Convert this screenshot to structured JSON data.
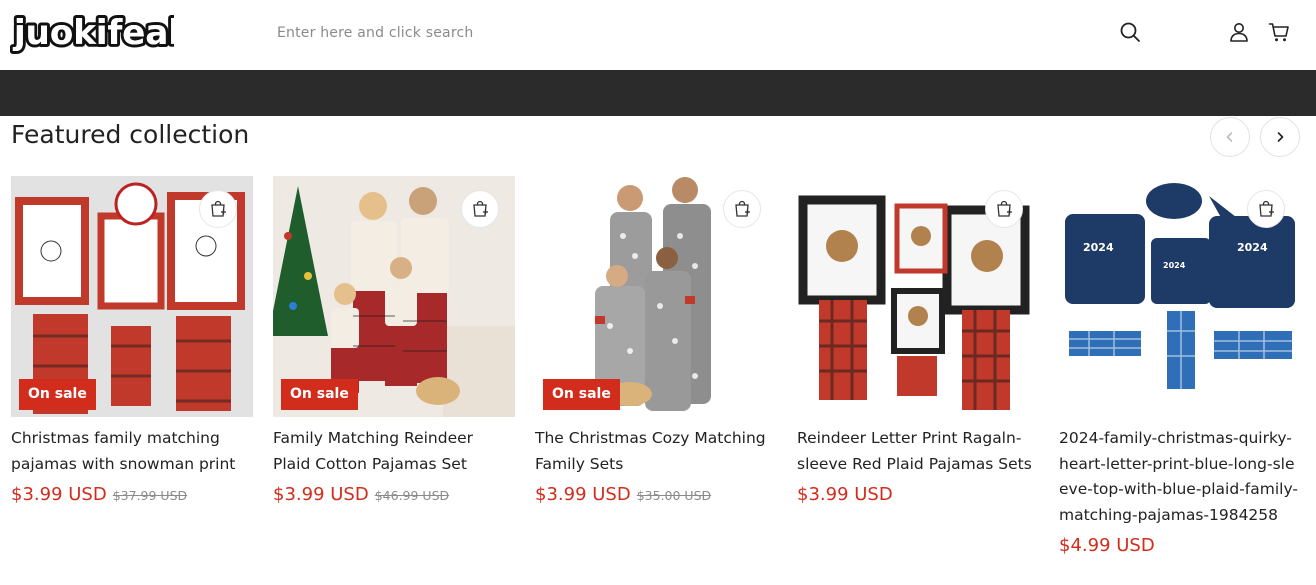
{
  "header": {
    "logo_text": "juokifeal",
    "search_placeholder": "Enter here and click search",
    "icons": {
      "search": "search-icon",
      "account": "user-icon",
      "cart": "cart-icon"
    }
  },
  "section": {
    "title": "Featured collection",
    "prev_icon": "chevron-left-icon",
    "next_icon": "chevron-right-icon"
  },
  "colors": {
    "accent": "#d22c1c",
    "banner": "#2b2b2b"
  },
  "products": [
    {
      "title": "Christmas family matching pajamas with snowman print",
      "badge": "On sale",
      "price": "$3.99 USD",
      "compare_price": "$37.99 USD"
    },
    {
      "title": "Family Matching Reindeer Plaid Cotton Pajamas Set",
      "badge": "On sale",
      "price": "$3.99 USD",
      "compare_price": "$46.99 USD"
    },
    {
      "title": "The Christmas Cozy Matching Family Sets",
      "badge": "On sale",
      "price": "$3.99 USD",
      "compare_price": "$35.00 USD"
    },
    {
      "title": "Reindeer Letter Print Ragaln-sleeve Red Plaid Pajamas Sets",
      "badge": "",
      "price": "$3.99 USD",
      "compare_price": ""
    },
    {
      "title": "2024-family-christmas-quirky-heart-letter-print-blue-long-sleeve-top-with-blue-plaid-family-matching-pajamas-1984258",
      "badge": "",
      "price": "$4.99 USD",
      "compare_price": ""
    }
  ]
}
